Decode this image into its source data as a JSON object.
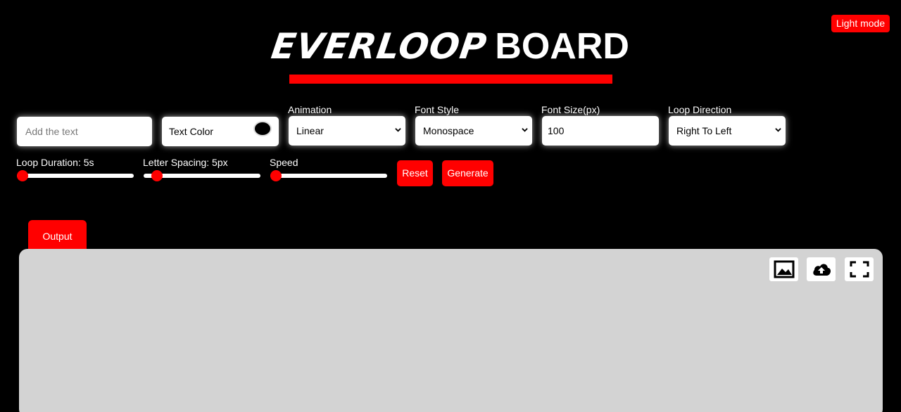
{
  "header": {
    "mode_button": "Light mode",
    "title_part1": "EVERLOOP",
    "title_part2": "BOARD"
  },
  "controls": {
    "text_input": {
      "placeholder": "Add the text",
      "value": ""
    },
    "text_color": {
      "label": "Text Color",
      "value": "#000000"
    },
    "animation": {
      "label": "Animation",
      "value": "Linear"
    },
    "font_style": {
      "label": "Font Style",
      "value": "Monospace"
    },
    "font_size": {
      "label": "Font Size(px)",
      "value": "100"
    },
    "loop_direction": {
      "label": "Loop Direction",
      "value": "Right To Left"
    },
    "loop_duration": {
      "label": "Loop Duration: 5s",
      "level": 0
    },
    "letter_spacing": {
      "label": "Letter Spacing: 5px",
      "level": 0.07
    },
    "speed": {
      "label": "Speed",
      "level": 0
    },
    "reset_label": "Reset",
    "generate_label": "Generate"
  },
  "output": {
    "tab_label": "Output",
    "icons": [
      "image-icon",
      "cloud-upload-icon",
      "fullscreen-icon"
    ]
  },
  "colors": {
    "accent": "#ff0000",
    "background": "#000000",
    "panel": "#d3d3d3"
  }
}
